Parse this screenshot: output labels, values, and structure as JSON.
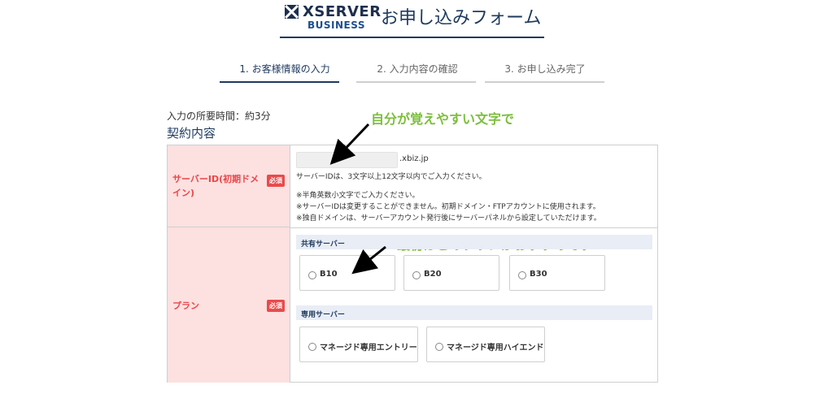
{
  "header": {
    "logo_top": "XSERVER",
    "logo_bottom": "BUSINESS",
    "title": "お申し込みフォーム"
  },
  "steps": [
    {
      "label": "1. お客様情報の入力",
      "active": true
    },
    {
      "label": "2. 入力内容の確認",
      "active": false
    },
    {
      "label": "3. お申し込み完了",
      "active": false
    }
  ],
  "time_required": "入力の所要時間：約3分",
  "section_title": "契約内容",
  "annotations": {
    "server_id_hint": "自分が覚えやすい文字で",
    "plan_hint": "最初はこのプランがおすすめです"
  },
  "server_id": {
    "label": "サーバーID(初期ドメイン)",
    "required": "必須",
    "input_value": "",
    "suffix": ".xbiz.jp",
    "help": "サーバーIDは、3文字以上12文字以内でご入力ください。",
    "notes": [
      "※半角英数小文字でご入力ください。",
      "※サーバーIDは変更することができません。初期ドメイン・FTPアカウントに使用されます。",
      "※独自ドメインは、サーバーアカウント発行後にサーバーパネルから設定していただけます。"
    ]
  },
  "plan": {
    "label": "プラン",
    "required": "必須",
    "shared_group": "共有サーバー",
    "shared_options": [
      "B10",
      "B20",
      "B30"
    ],
    "dedicated_group": "専用サーバー",
    "dedicated_options": [
      "マネージド専用エントリー",
      "マネージド専用ハイエンド"
    ]
  },
  "colors": {
    "navy": "#1e3a5f",
    "required_red": "#e84b4b",
    "label_bg": "#fde0e0",
    "annotation_green": "#7cbf3c"
  }
}
